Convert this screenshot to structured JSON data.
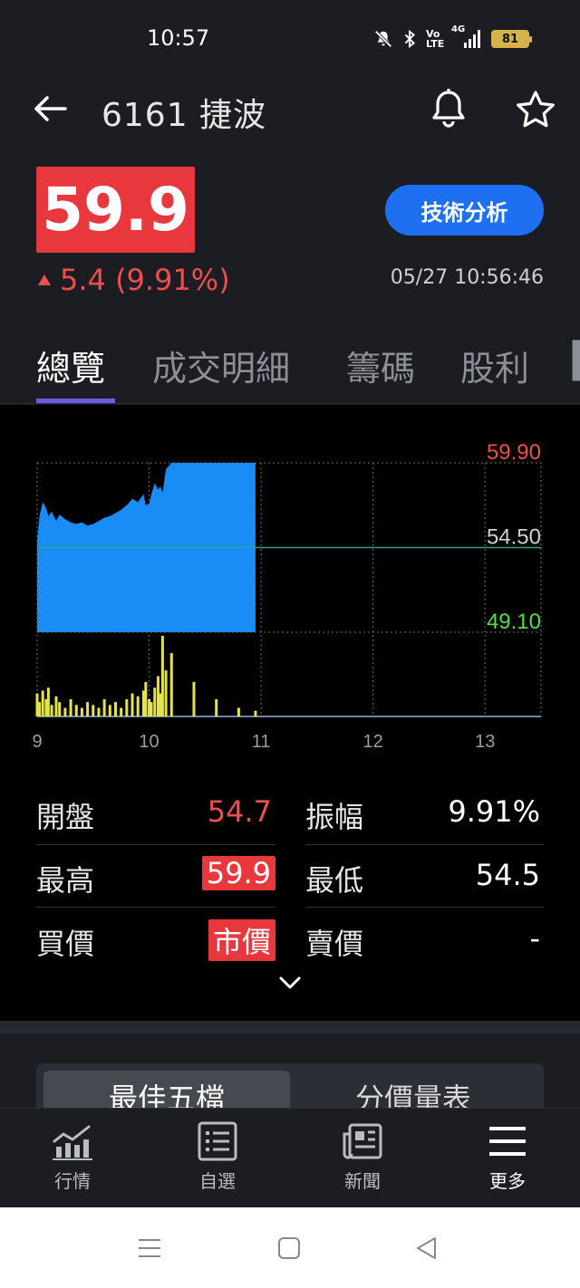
{
  "status_bar": {
    "time": "10:57",
    "network": "4G",
    "volte": "Vo LTE",
    "battery": "81"
  },
  "header": {
    "title": "6161 捷波"
  },
  "quote": {
    "price": "59.9",
    "change": "5.4 (9.91%)",
    "timestamp": "05/27 10:56:46",
    "tech_button": "技術分析"
  },
  "tabs": [
    "總覽",
    "成交明細",
    "籌碼",
    "股利"
  ],
  "chart": {
    "y_labels": {
      "high": "59.90",
      "ref": "54.50",
      "low": "49.10"
    },
    "x_labels": [
      "9",
      "10",
      "11",
      "12",
      "13"
    ]
  },
  "chart_data": {
    "type": "area",
    "title": "",
    "x_unit": "hour",
    "xlim": [
      9,
      13.5
    ],
    "ylim": [
      49.1,
      59.9
    ],
    "reference": 54.5,
    "x": [
      9.0,
      9.02,
      9.05,
      9.08,
      9.1,
      9.13,
      9.17,
      9.2,
      9.25,
      9.3,
      9.35,
      9.4,
      9.45,
      9.5,
      9.55,
      9.6,
      9.65,
      9.7,
      9.75,
      9.8,
      9.85,
      9.9,
      9.95,
      9.97,
      10.0,
      10.02,
      10.05,
      10.08,
      10.1,
      10.12,
      10.15,
      10.2,
      10.4,
      10.6,
      10.8,
      10.95
    ],
    "price": [
      54.9,
      56.5,
      57.4,
      57.0,
      56.5,
      56.8,
      56.2,
      56.6,
      56.3,
      56.1,
      56.0,
      56.1,
      55.9,
      56.0,
      56.2,
      56.4,
      56.5,
      56.7,
      56.9,
      57.2,
      57.6,
      57.4,
      57.9,
      57.2,
      57.3,
      57.9,
      58.6,
      58.2,
      58.4,
      58.0,
      59.5,
      59.9,
      59.9,
      59.9,
      59.9,
      59.9
    ],
    "volume_series": {
      "name": "",
      "note_unit": "relative"
    },
    "volume": [
      8,
      5,
      9,
      6,
      10,
      4,
      7,
      5,
      3,
      6,
      4,
      3,
      5,
      4,
      3,
      6,
      4,
      5,
      3,
      6,
      8,
      7,
      9,
      12,
      6,
      5,
      10,
      14,
      8,
      28,
      16,
      22,
      12,
      6,
      3,
      2
    ]
  },
  "stats": {
    "open_label": "開盤",
    "open": "54.7",
    "amp_label": "振幅",
    "amp": "9.91%",
    "high_label": "最高",
    "high": "59.9",
    "low_label": "最低",
    "low": "54.5",
    "bid_label": "買價",
    "bid": "市價",
    "ask_label": "賣價",
    "ask": "-"
  },
  "segments": {
    "best_five": "最佳五檔",
    "price_volume": "分價量表"
  },
  "bottom_nav": [
    {
      "label": "行情",
      "icon": "chart-icon"
    },
    {
      "label": "自選",
      "icon": "list-icon"
    },
    {
      "label": "新聞",
      "icon": "news-icon"
    },
    {
      "label": "更多",
      "icon": "menu-icon"
    }
  ],
  "colors": {
    "up": "#ef4e4e",
    "accent": "#1e6ff2",
    "area": "#1a8cf5",
    "volume": "#e6e34a",
    "down": "#4ce04c",
    "tab_indicator": "#6a5ce6"
  }
}
